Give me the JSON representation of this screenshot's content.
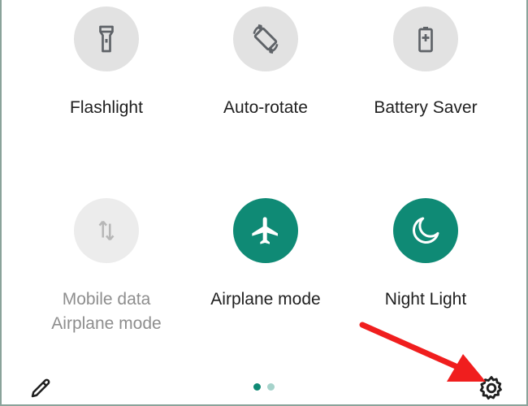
{
  "tiles": [
    {
      "label": "Flashlight",
      "icon": "flashlight-icon",
      "state": "off"
    },
    {
      "label": "Auto-rotate",
      "icon": "auto-rotate-icon",
      "state": "off"
    },
    {
      "label": "Battery Saver",
      "icon": "battery-saver-icon",
      "state": "off"
    },
    {
      "label": "Mobile data",
      "sublabel": "Airplane mode",
      "icon": "mobile-data-icon",
      "state": "disabled"
    },
    {
      "label": "Airplane mode",
      "icon": "airplane-icon",
      "state": "on"
    },
    {
      "label": "Night Light",
      "icon": "night-light-icon",
      "state": "on"
    }
  ],
  "footer": {
    "edit_icon": "pencil-icon",
    "settings_icon": "gear-icon",
    "page_count": 2,
    "active_page": 1
  },
  "colors": {
    "accent": "#0f8a75",
    "tile_off": "#e2e2e2",
    "annotation_arrow": "#f01e1e"
  }
}
